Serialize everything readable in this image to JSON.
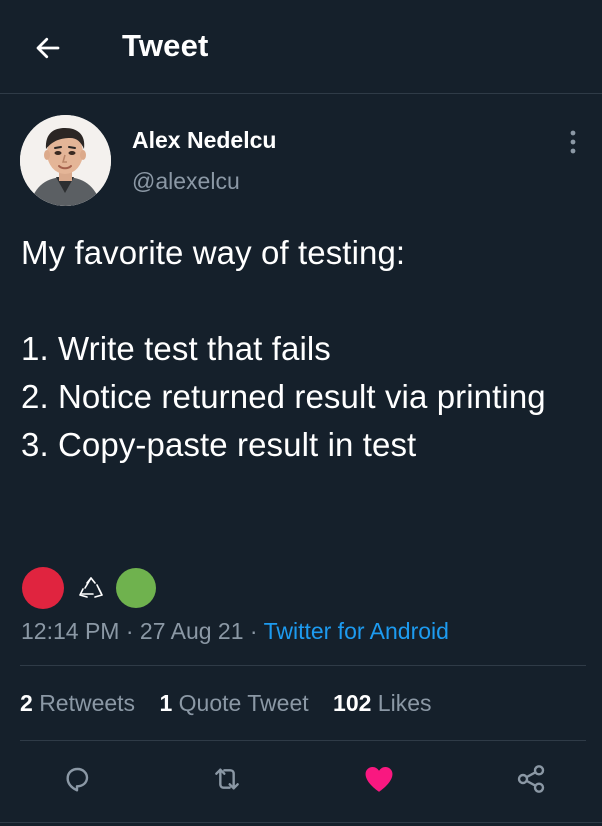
{
  "header": {
    "title": "Tweet",
    "back_icon": "arrow-left-icon"
  },
  "tweet": {
    "display_name": "Alex Nedelcu",
    "handle": "@alexelcu",
    "text": "My favorite way of testing:\n\n1. Write test that fails\n2. Notice returned result via printing\n3. Copy-paste result in test",
    "emoji": [
      "red-circle",
      "recycle-symbol",
      "green-circle"
    ],
    "time": "12:14 PM",
    "separator": "·",
    "date": "27 Aug 21",
    "source": "Twitter for Android"
  },
  "stats": {
    "retweets_count": "2",
    "retweets_label": "Retweets",
    "quotes_count": "1",
    "quotes_label": "Quote Tweet",
    "likes_count": "102",
    "likes_label": "Likes"
  },
  "actions": [
    "reply-icon",
    "retweet-icon",
    "like-icon",
    "share-icon"
  ],
  "colors": {
    "background": "#15202b",
    "text": "#ffffff",
    "muted": "#8b98a5",
    "link": "#1d9bf0",
    "like": "#f91880",
    "red_circle": "#e0243f",
    "green_circle": "#6fb24e"
  }
}
